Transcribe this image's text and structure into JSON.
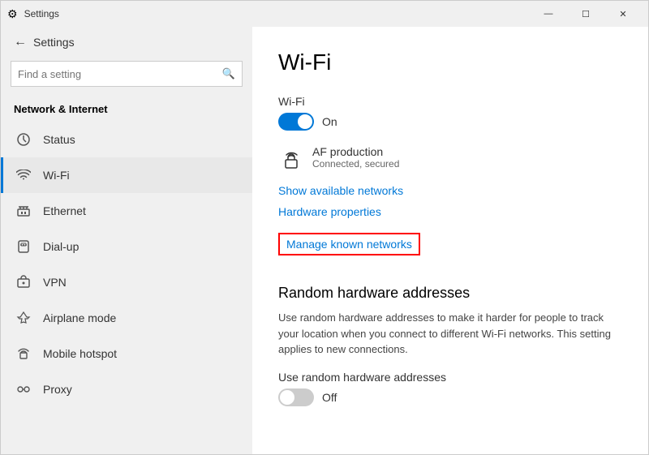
{
  "titlebar": {
    "title": "Settings",
    "minimize": "—",
    "maximize": "☐",
    "close": "✕"
  },
  "sidebar": {
    "back_label": "Settings",
    "search_placeholder": "Find a setting",
    "category": "Network & Internet",
    "items": [
      {
        "id": "status",
        "label": "Status",
        "icon": "status"
      },
      {
        "id": "wifi",
        "label": "Wi-Fi",
        "icon": "wifi",
        "active": true
      },
      {
        "id": "ethernet",
        "label": "Ethernet",
        "icon": "ethernet"
      },
      {
        "id": "dialup",
        "label": "Dial-up",
        "icon": "dialup"
      },
      {
        "id": "vpn",
        "label": "VPN",
        "icon": "vpn"
      },
      {
        "id": "airplane",
        "label": "Airplane mode",
        "icon": "airplane"
      },
      {
        "id": "hotspot",
        "label": "Mobile hotspot",
        "icon": "hotspot"
      },
      {
        "id": "proxy",
        "label": "Proxy",
        "icon": "proxy"
      }
    ]
  },
  "main": {
    "title": "Wi-Fi",
    "wifi_label": "Wi-Fi",
    "wifi_state": "On",
    "wifi_on": true,
    "network_name": "AF production",
    "network_status": "Connected, secured",
    "show_networks": "Show available networks",
    "hardware_properties": "Hardware properties",
    "manage_networks": "Manage known networks",
    "random_heading": "Random hardware addresses",
    "random_body": "Use random hardware addresses to make it harder for people to track your location when you connect to different Wi-Fi networks. This setting applies to new connections.",
    "random_label": "Use random hardware addresses",
    "random_state": "Off",
    "random_on": false
  }
}
